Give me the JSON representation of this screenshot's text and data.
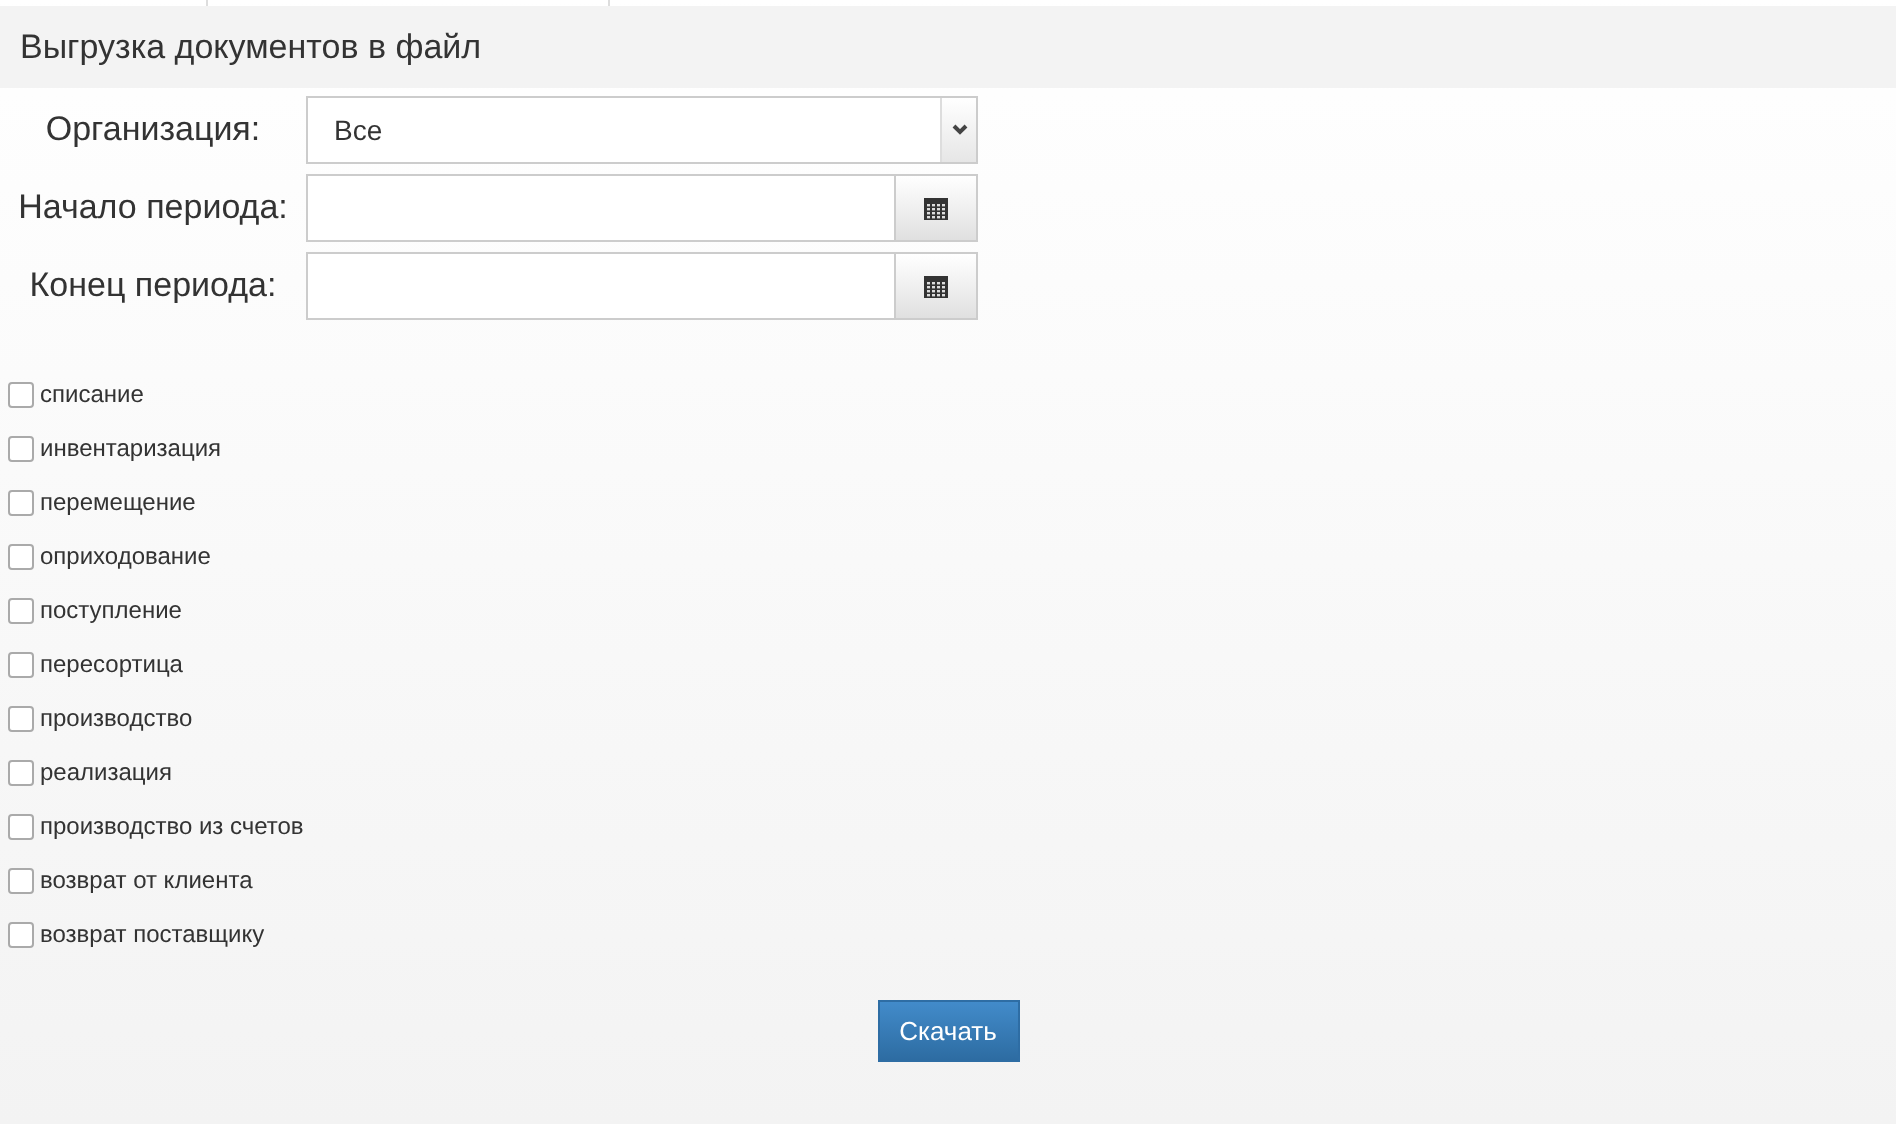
{
  "header": {
    "title": "Выгрузка документов в файл"
  },
  "fields": [
    {
      "kind": "select",
      "label": "Организация:",
      "value": "Все"
    },
    {
      "kind": "date",
      "label": "Начало периода:"
    },
    {
      "kind": "date",
      "label": "Конец периода:"
    }
  ],
  "document_types": [
    {
      "label": "списание",
      "checked": false
    },
    {
      "label": "инвентаризация",
      "checked": false
    },
    {
      "label": "перемещение",
      "checked": false
    },
    {
      "label": "оприходование",
      "checked": false
    },
    {
      "label": "поступление",
      "checked": false
    },
    {
      "label": "пересортица",
      "checked": false
    },
    {
      "label": "производство",
      "checked": false
    },
    {
      "label": "реализация",
      "checked": false
    },
    {
      "label": "производство из счетов",
      "checked": false
    },
    {
      "label": "возврат от клиента",
      "checked": false
    },
    {
      "label": "возврат поставщику",
      "checked": false
    }
  ],
  "download_button": "Скачать"
}
